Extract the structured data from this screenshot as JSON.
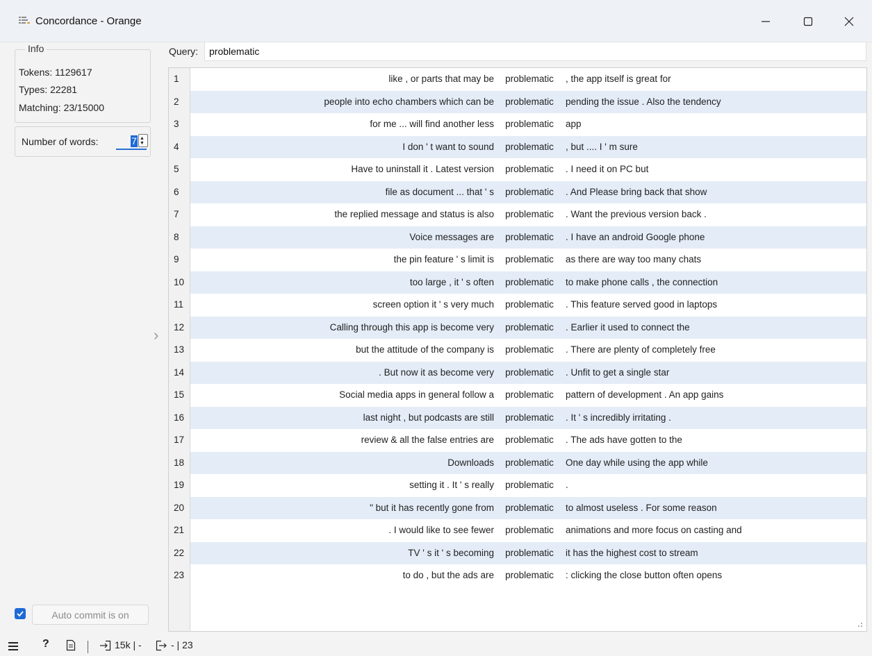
{
  "window": {
    "title": "Concordance - Orange",
    "app_icon": "orange-widget-icon",
    "controls": [
      "minimize-icon",
      "maximize-icon",
      "close-icon"
    ]
  },
  "info": {
    "legend": "Info",
    "tokens": "Tokens: 1129617",
    "types": "Types: 22281",
    "matching": "Matching: 23/15000"
  },
  "words": {
    "label": "Number of words:",
    "value": "7"
  },
  "auto_commit": {
    "checked": true,
    "label": "Auto commit is on"
  },
  "query": {
    "label": "Query:",
    "value": "problematic"
  },
  "results": [
    {
      "n": "1",
      "left": "like , or parts that may be",
      "word": "problematic",
      "right": ", the app itself is great for"
    },
    {
      "n": "2",
      "left": "people into echo chambers which can be",
      "word": "problematic",
      "right": "pending the issue . Also the tendency"
    },
    {
      "n": "3",
      "left": "for me ... will find another less",
      "word": "problematic",
      "right": "app"
    },
    {
      "n": "4",
      "left": "I don ' t want to sound",
      "word": "problematic",
      "right": ", but .... I ' m sure"
    },
    {
      "n": "5",
      "left": "Have to uninstall it . Latest version",
      "word": "problematic",
      "right": ". I need it on PC but"
    },
    {
      "n": "6",
      "left": "file as document ... that ' s",
      "word": "problematic",
      "right": ". And Please bring back that show"
    },
    {
      "n": "7",
      "left": "the replied message and status is also",
      "word": "problematic",
      "right": ". Want the previous version back ."
    },
    {
      "n": "8",
      "left": "Voice messages are",
      "word": "problematic",
      "right": ". I have an android Google phone"
    },
    {
      "n": "9",
      "left": "the pin feature ' s limit is",
      "word": "problematic",
      "right": "as there are way too many chats"
    },
    {
      "n": "10",
      "left": "too large , it ' s often",
      "word": "problematic",
      "right": "to make phone calls , the connection"
    },
    {
      "n": "11",
      "left": "screen option it ' s very much",
      "word": "problematic",
      "right": ". This feature served good in laptops"
    },
    {
      "n": "12",
      "left": "Calling through this app is become very",
      "word": "problematic",
      "right": ". Earlier it used to connect the"
    },
    {
      "n": "13",
      "left": "but the attitude of the company is",
      "word": "problematic",
      "right": ". There are plenty of completely free"
    },
    {
      "n": "14",
      "left": ". But now it as become very",
      "word": "problematic",
      "right": ". Unfit to get a single star"
    },
    {
      "n": "15",
      "left": "Social media apps in general follow a",
      "word": "problematic",
      "right": "pattern of development . An app gains"
    },
    {
      "n": "16",
      "left": "last night , but podcasts are still",
      "word": "problematic",
      "right": ". It ' s incredibly irritating ."
    },
    {
      "n": "17",
      "left": "review & all the false entries are",
      "word": "problematic",
      "right": ". The ads have gotten to the"
    },
    {
      "n": "18",
      "left": "Downloads",
      "word": "problematic",
      "right": "One day while using the app while"
    },
    {
      "n": "19",
      "left": "setting it . It ' s really",
      "word": "problematic",
      "right": "."
    },
    {
      "n": "20",
      "left": "\" but it has recently gone from",
      "word": "problematic",
      "right": "to almost useless . For some reason"
    },
    {
      "n": "21",
      "left": ". I would like to see fewer",
      "word": "problematic",
      "right": "animations and more focus on casting and"
    },
    {
      "n": "22",
      "left": "TV ' s it ' s becoming",
      "word": "problematic",
      "right": "it has the highest cost to stream"
    },
    {
      "n": "23",
      "left": "to do , but the ads are",
      "word": "problematic",
      "right": ": clicking the close button often opens"
    }
  ],
  "statusbar": {
    "icons": [
      "menu-icon",
      "help-icon",
      "report-icon",
      "input-icon",
      "output-icon"
    ],
    "input_summary": "15k | -",
    "output_summary": "- | 23"
  },
  "colors": {
    "accent": "#1d6ad6",
    "row_alt": "#e4ecf7",
    "titlebar": "#eef1f5"
  }
}
